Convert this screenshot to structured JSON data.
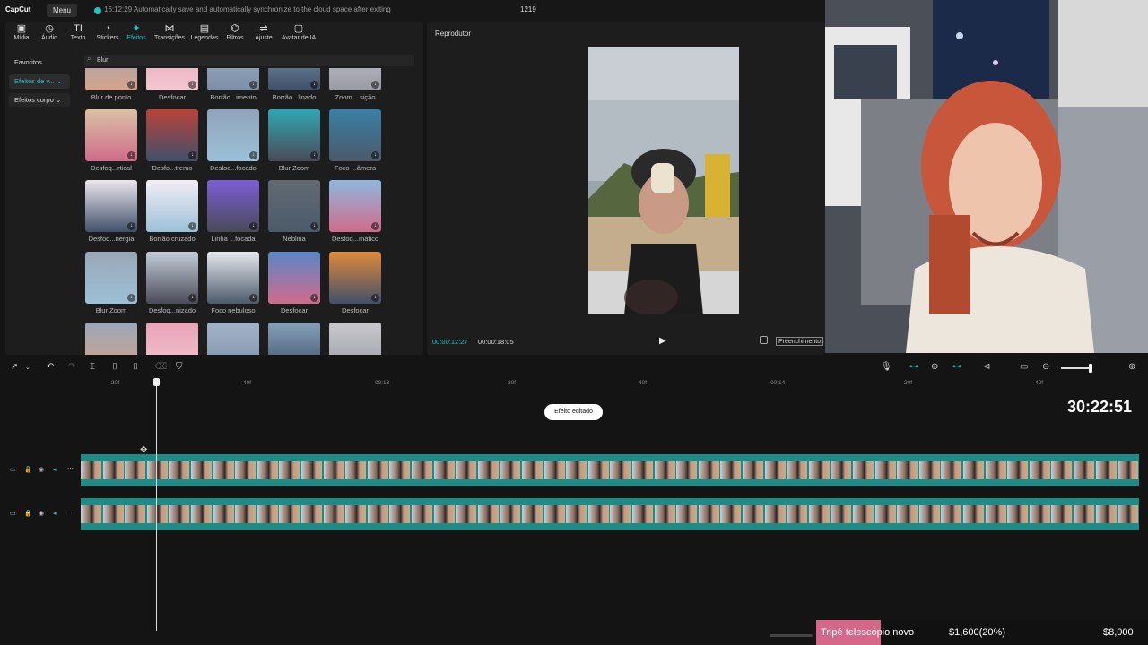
{
  "app": {
    "brand": "CapCut",
    "menu_label": "Menu",
    "save_status": "16:12:29 Automatically save and automatically synchronize to the cloud space after exiting",
    "project_title": "1219"
  },
  "toolbar": {
    "items": [
      {
        "label": "Mídia",
        "icon": "media-icon"
      },
      {
        "label": "Áudio",
        "icon": "audio-icon"
      },
      {
        "label": "Texto",
        "icon": "text-icon"
      },
      {
        "label": "Stickers",
        "icon": "sticker-icon"
      },
      {
        "label": "Efeitos",
        "icon": "effects-icon",
        "active": true
      },
      {
        "label": "Transições",
        "icon": "transitions-icon"
      },
      {
        "label": "Legendas",
        "icon": "captions-icon"
      },
      {
        "label": "Filtros",
        "icon": "filters-icon"
      },
      {
        "label": "Ajuste",
        "icon": "adjust-icon"
      },
      {
        "label": "Avatar de IA",
        "icon": "ai-avatar-icon"
      }
    ]
  },
  "sidebar": {
    "items": [
      {
        "label": "Favoritos"
      },
      {
        "label": "Efeitos de v... ⌄"
      },
      {
        "label": "Efeitos corpo ⌄"
      }
    ]
  },
  "search": {
    "value": "Blur"
  },
  "effects": {
    "rows": [
      [
        "Blur de ponto",
        "Desfocar",
        "Borrão...imento",
        "Borrão...linado",
        "Zoom ...sição"
      ],
      [
        "Desfoq...rtical",
        "Desfo...tremo",
        "Desloc...focado",
        "Blur Zoom",
        "Foco ...âmera"
      ],
      [
        "Desfoq...nergia",
        "Borrão cruzado",
        "Linha ...focada",
        "Neblina",
        "Desfoq...mático"
      ],
      [
        "Blur Zoom",
        "Desfoq...nizado",
        "Foco nebuloso",
        "Desfocar",
        "Desfocar"
      ]
    ]
  },
  "player": {
    "title": "Reprodutor",
    "current_time": "00:00:12:27",
    "duration": "00:00:18:05",
    "fill_label": "Preenchimento"
  },
  "timeline": {
    "ruler_ticks": [
      "20f",
      "40f",
      "00:13",
      "20f",
      "40f",
      "00:14",
      "20f",
      "40f"
    ],
    "badge": "Efeito editado",
    "timer": "30:22:51"
  },
  "ticker": {
    "label": "Tripé telescópio novo",
    "mid": "$1,600(20%)",
    "right": "$8,000"
  },
  "colors": {
    "accent": "#23c2c8",
    "track": "#1f8b86",
    "ticker_label_bg": "#d4678a"
  }
}
